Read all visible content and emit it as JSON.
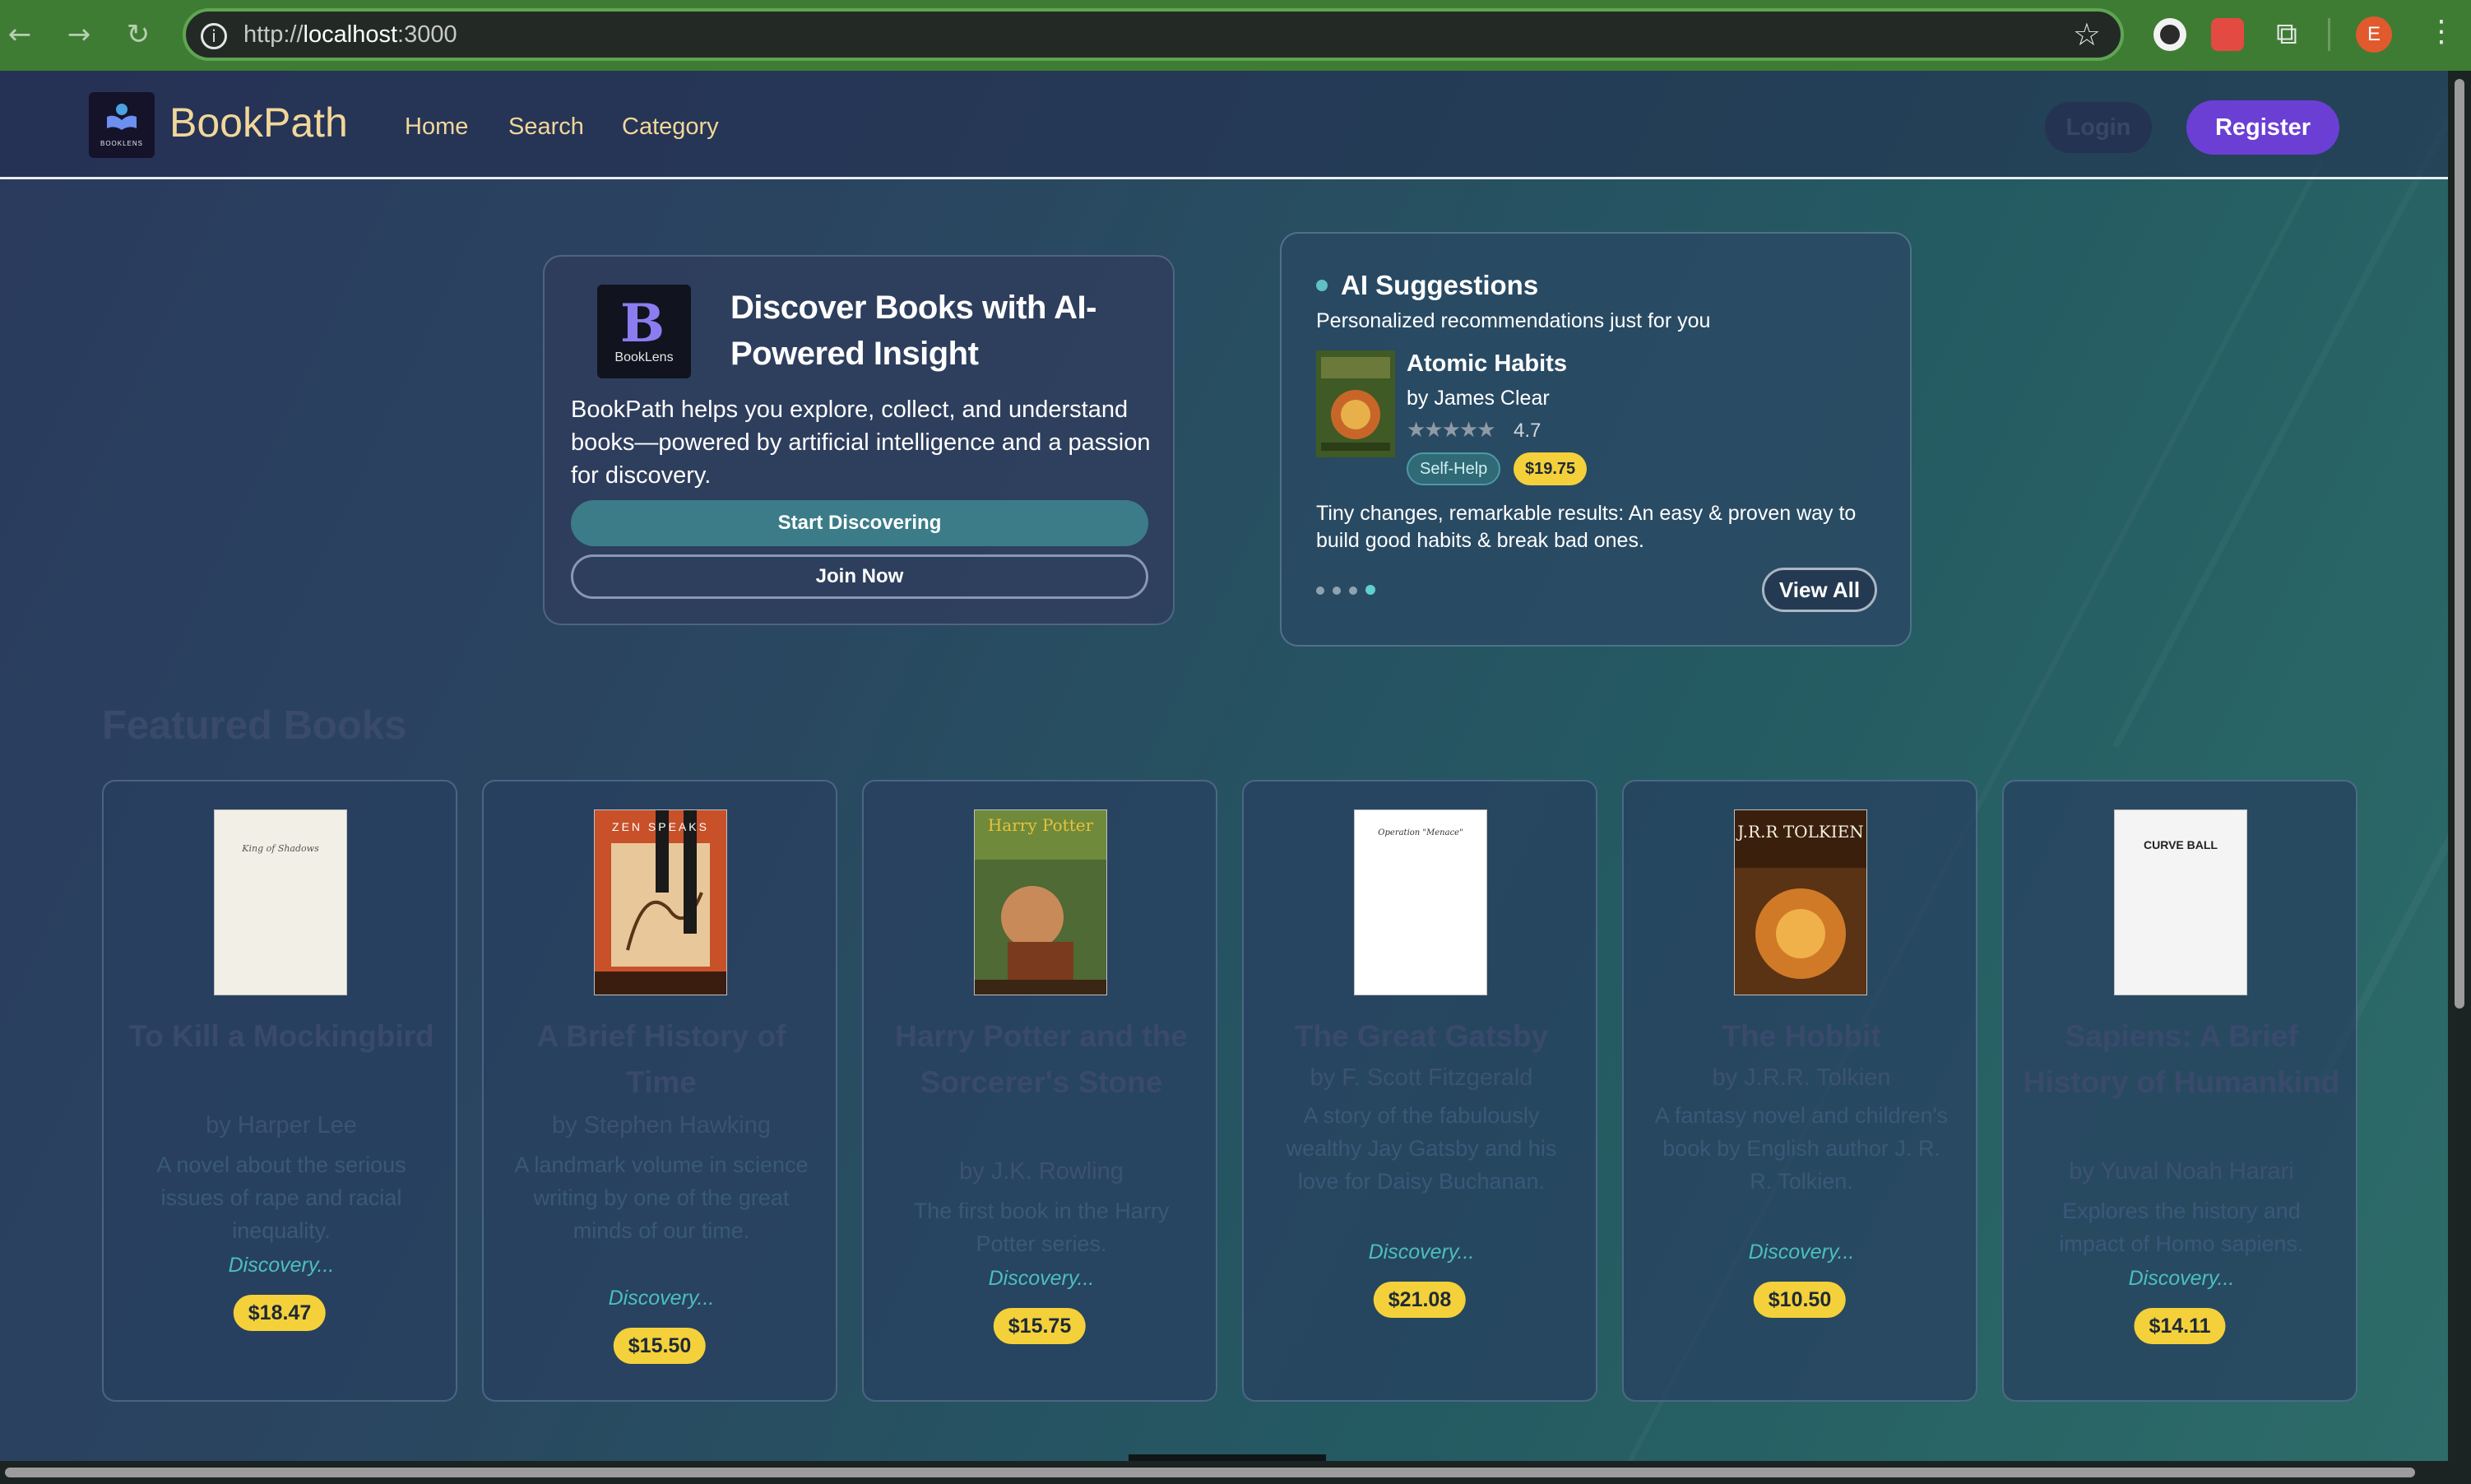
{
  "browser": {
    "url_prefix": "http://",
    "url_host": "localhost",
    "url_port": ":3000",
    "profile_initial": "E"
  },
  "header": {
    "brand": "BookPath",
    "logo_caption": "BOOKLENS",
    "nav": [
      "Home",
      "Search",
      "Category"
    ],
    "login_label": "Login",
    "register_label": "Register"
  },
  "hero": {
    "logo_caption": "BookLens",
    "title": "Discover Books with AI-Powered Insight",
    "description": "BookPath helps you explore, collect, and understand books—powered by artificial intelligence and a passion for discovery.",
    "start_label": "Start Discovering",
    "join_label": "Join Now"
  },
  "ai_suggestions": {
    "title": "AI Suggestions",
    "subtitle": "Personalized recommendations just for you",
    "book": {
      "title": "Atomic Habits",
      "author": "by James Clear",
      "stars": "★★★★★",
      "rating": "4.7",
      "category": "Self-Help",
      "price": "$19.75",
      "description": "Tiny changes, remarkable results: An easy & proven way to build good habits & break bad ones."
    },
    "carousel_count": 4,
    "carousel_active": 4,
    "view_all_label": "View All"
  },
  "featured": {
    "title": "Featured Books",
    "books": [
      {
        "title": "To Kill a Mockingbird",
        "author": "by Harper Lee",
        "description": "A novel about the serious issues of rape and racial inequality.",
        "category": "Discovery...",
        "price": "$18.47",
        "cover_text": "King of Shadows"
      },
      {
        "title": "A Brief History of Time",
        "author": "by Stephen Hawking",
        "description": "A landmark volume in science writing by one of the great minds of our time.",
        "category": "Discovery...",
        "price": "$15.50",
        "cover_text": "ZEN SPEAKS"
      },
      {
        "title": "Harry Potter and the Sorcerer's Stone",
        "author": "by J.K. Rowling",
        "description": "The first book in the Harry Potter series.",
        "category": "Discovery...",
        "price": "$15.75",
        "cover_text": "Harry Potter"
      },
      {
        "title": "The Great Gatsby",
        "author": "by F. Scott Fitzgerald",
        "description": "A story of the fabulously wealthy Jay Gatsby and his love for Daisy Buchanan.",
        "category": "Discovery...",
        "price": "$21.08",
        "cover_text": "Operation \"Menace\""
      },
      {
        "title": "The Hobbit",
        "author": "by J.R.R. Tolkien",
        "description": "A fantasy novel and children's book by English author J. R. R. Tolkien.",
        "category": "Discovery...",
        "price": "$10.50",
        "cover_text": "J.R.R TOLKIEN"
      },
      {
        "title": "Sapiens: A Brief History of Humankind",
        "author": "by Yuval Noah Harari",
        "description": "Explores the history and impact of Homo sapiens.",
        "category": "Discovery...",
        "price": "$14.11",
        "cover_text": "CURVE BALL"
      }
    ]
  }
}
